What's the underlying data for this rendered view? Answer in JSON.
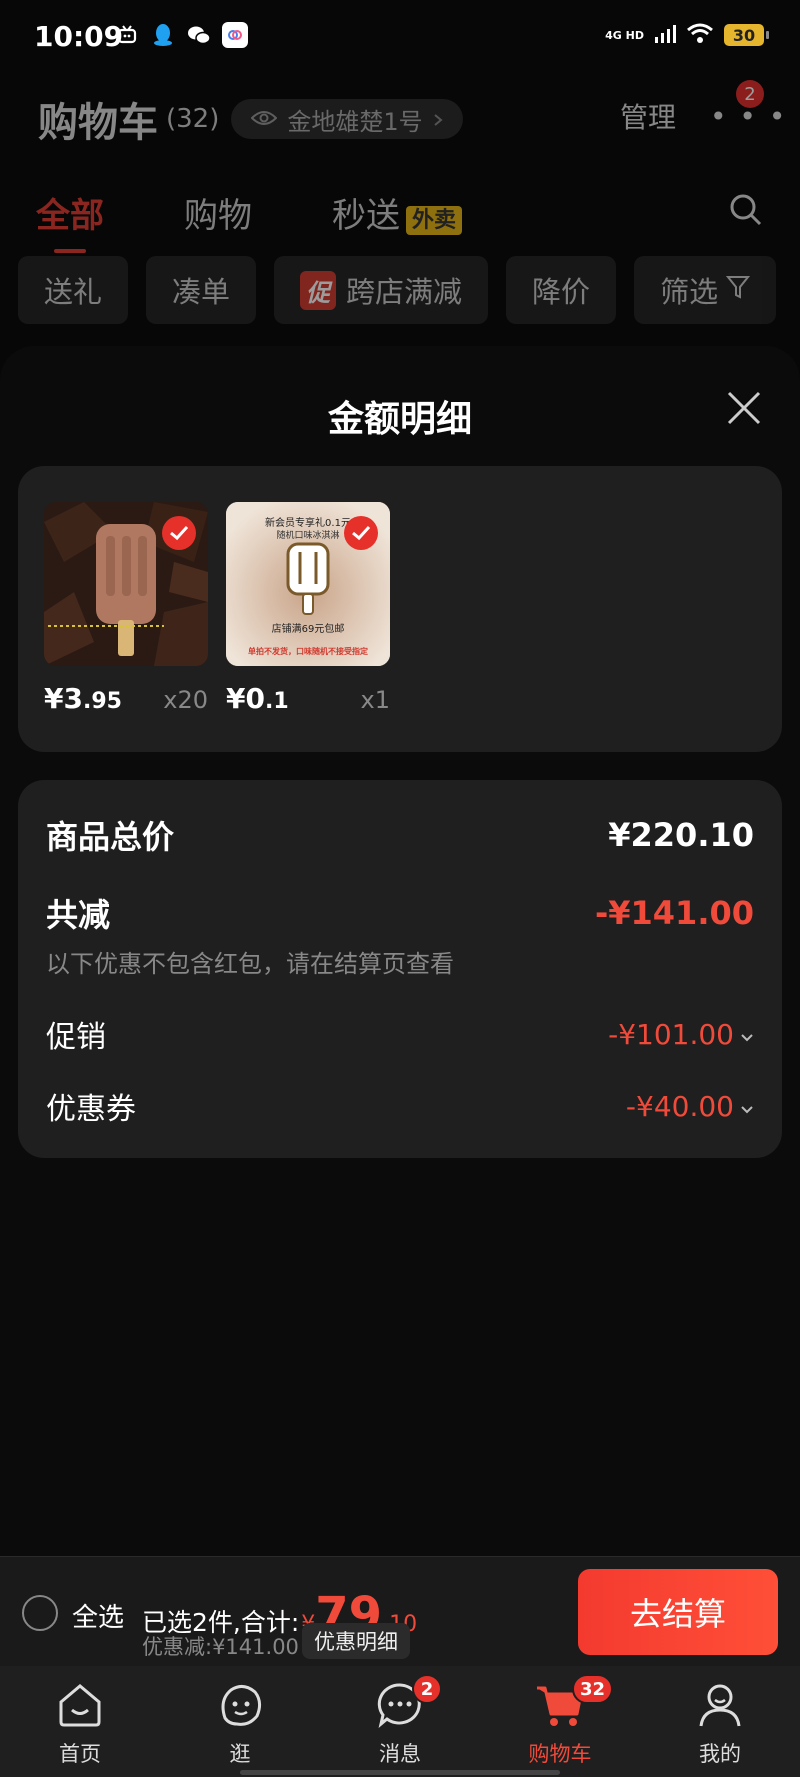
{
  "status_bar": {
    "time": "10:09",
    "network": "4G HD",
    "battery": "30"
  },
  "header": {
    "title": "购物车",
    "count": "(32)",
    "address": "金地雄楚1号",
    "manage": "管理",
    "more_badge": "2"
  },
  "tabs": [
    {
      "label": "全部"
    },
    {
      "label": "购物"
    },
    {
      "label": "秒送",
      "badge": "外卖"
    }
  ],
  "filters": [
    {
      "label": "送礼"
    },
    {
      "label": "凑单"
    },
    {
      "label": "跨店满减",
      "tag": "促"
    },
    {
      "label": "降价"
    },
    {
      "label": "筛选"
    }
  ],
  "sheet": {
    "title": "金额明细",
    "items": [
      {
        "price_int": "¥3",
        "price_dec": ".95",
        "qty": "x20"
      },
      {
        "price_int": "¥0",
        "price_dec": ".1",
        "qty": "x1",
        "img_line1": "新会员专享礼0.1元",
        "img_line2": "随机口味冰淇淋",
        "img_line3": "店铺满69元包邮",
        "img_line4": "单拍不发货，口味随机不接受指定"
      }
    ],
    "summary": {
      "total_label": "商品总价",
      "total_value": "¥220.10",
      "reduce_label": "共减",
      "reduce_value": "-¥141.00",
      "note": "以下优惠不包含红包，请在结算页查看",
      "promo_label": "促销",
      "promo_value": "-¥101.00",
      "coupon_label": "优惠券",
      "coupon_value": "-¥40.00"
    }
  },
  "checkout": {
    "select_all": "全选",
    "selected_text": "已选2件,合计:",
    "total_yen": "¥",
    "total_int": "79",
    "total_dec": ".10",
    "discount": "优惠减:¥141.00",
    "discount_detail": "优惠明细",
    "button": "去结算"
  },
  "nav": [
    {
      "label": "首页",
      "icon": "home-icon"
    },
    {
      "label": "逛",
      "icon": "browse-icon"
    },
    {
      "label": "消息",
      "icon": "message-icon",
      "badge": "2"
    },
    {
      "label": "购物车",
      "icon": "cart-icon",
      "badge": "32",
      "active": true
    },
    {
      "label": "我的",
      "icon": "profile-icon"
    }
  ],
  "colors": {
    "accent": "#f04a3a",
    "background": "#070707",
    "card": "#1f1f1f"
  }
}
